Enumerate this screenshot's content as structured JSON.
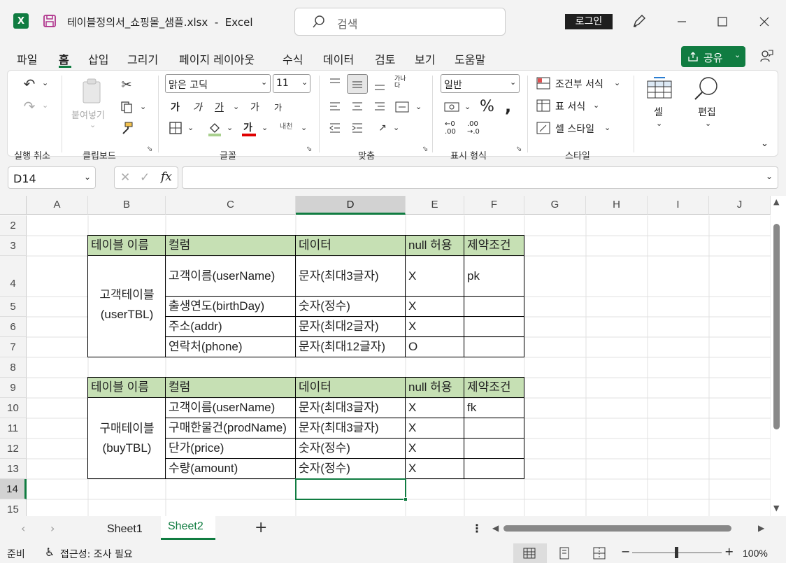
{
  "titlebar": {
    "app_badge": "X",
    "file_title": "테이블정의서_쇼핑몰_샘플.xlsx  -  Excel",
    "search_placeholder": "검색",
    "login_label": "로그인"
  },
  "menu": {
    "tabs": [
      "파일",
      "홈",
      "삽입",
      "그리기",
      "페이지 레이아웃",
      "수식",
      "데이터",
      "검토",
      "보기",
      "도움말"
    ],
    "active_tab": "홈",
    "share_label": "공유"
  },
  "ribbon": {
    "paste_label": "붙여넣기",
    "font_name": "맑은 고딕",
    "font_size": "11",
    "bold_glyph": "가",
    "italic_glyph": "가",
    "underline_glyph": "가",
    "grow_glyph": "가",
    "shrink_glyph": "가",
    "wrap_glyph": "가나다",
    "phonetic_glyph": "내천",
    "font_color_glyph": "가",
    "number_format": "일반",
    "cond_format": "조건부 서식",
    "table_format": "표 서식",
    "cell_style": "셀 스타일",
    "cells_label": "셀",
    "edit_label": "편집",
    "groups": {
      "undo": "실행 취소",
      "clipboard": "클립보드",
      "font": "글꼴",
      "align": "맞춤",
      "number": "표시 형식",
      "style": "스타일"
    }
  },
  "formula": {
    "name_box": "D14",
    "fx": "fx",
    "content": ""
  },
  "grid": {
    "columns": [
      "A",
      "B",
      "C",
      "D",
      "E",
      "F",
      "G",
      "H",
      "I",
      "J"
    ],
    "rows": [
      "2",
      "3",
      "4",
      "5",
      "6",
      "7",
      "8",
      "9",
      "10",
      "11",
      "12",
      "13",
      "14",
      "15"
    ],
    "table1": {
      "headers": [
        "테이블 이름",
        "컬럼",
        "데이터",
        "null 허용",
        "제약조건"
      ],
      "table_name": "고객테이블",
      "table_name_en": "(userTBL)",
      "rows": [
        [
          "고객이름(userName)",
          "문자(최대3글자)",
          "X",
          "pk"
        ],
        [
          "출생연도(birthDay)",
          "숫자(정수)",
          "X",
          ""
        ],
        [
          "주소(addr)",
          "문자(최대2글자)",
          "X",
          ""
        ],
        [
          "연락처(phone)",
          "문자(최대12글자)",
          "O",
          ""
        ]
      ]
    },
    "table2": {
      "headers": [
        "테이블 이름",
        "컬럼",
        "데이터",
        "null 허용",
        "제약조건"
      ],
      "table_name": "구매테이블",
      "table_name_en": "(buyTBL)",
      "rows": [
        [
          "고객이름(userName)",
          "문자(최대3글자)",
          "X",
          "fk"
        ],
        [
          "구매한물건(prodName)",
          "문자(최대3글자)",
          "X",
          ""
        ],
        [
          "단가(price)",
          "숫자(정수)",
          "X",
          ""
        ],
        [
          "수량(amount)",
          "숫자(정수)",
          "X",
          ""
        ]
      ]
    },
    "header_fill": "#c6e0b4",
    "active_cell": "D14"
  },
  "sheets": {
    "tabs": [
      "Sheet1",
      "Sheet2"
    ],
    "active": "Sheet2",
    "add_label": "+"
  },
  "status": {
    "ready": "준비",
    "accessibility": "접근성: 조사 필요",
    "zoom": "100%"
  }
}
